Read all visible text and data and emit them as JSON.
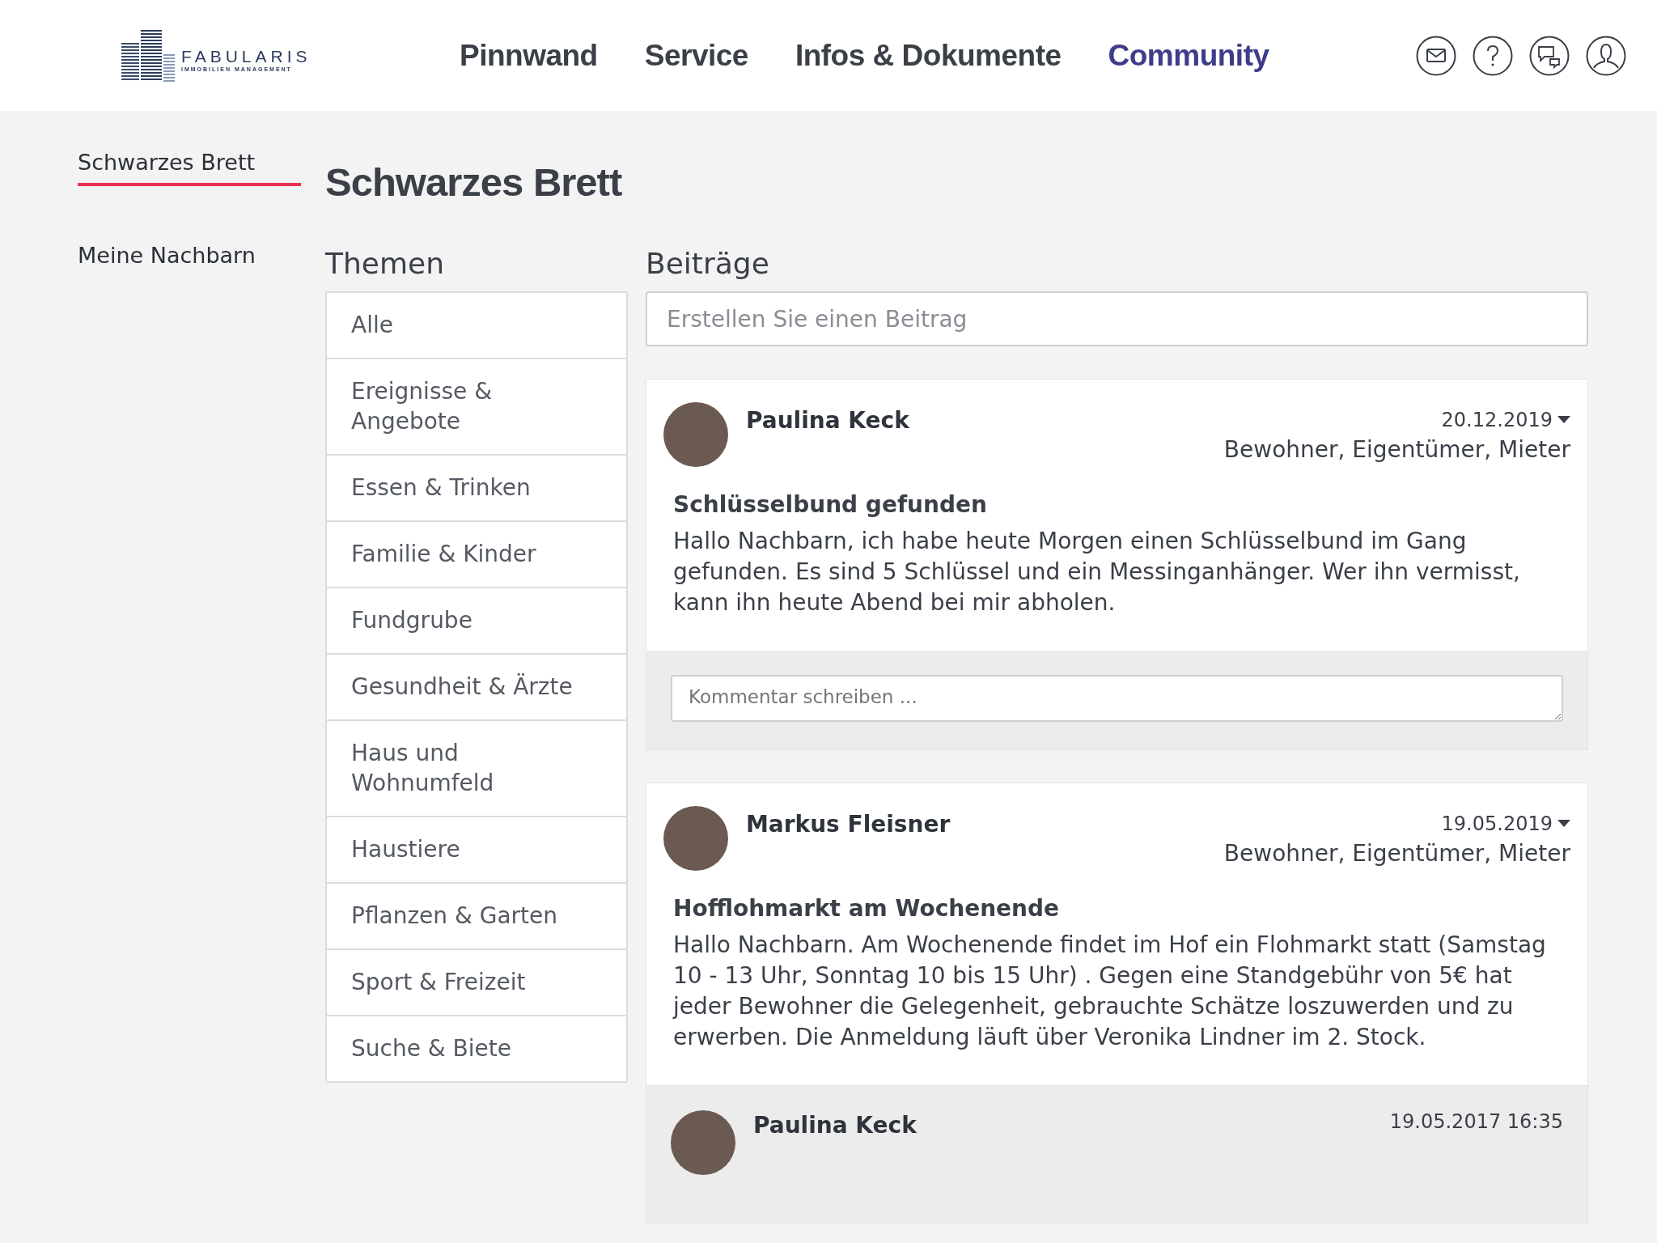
{
  "header": {
    "logo": {
      "name": "FABULARIS",
      "tagline": "IMMOBILIEN MANAGEMENT"
    },
    "nav": [
      {
        "label": "Pinnwand",
        "selected": false
      },
      {
        "label": "Service",
        "selected": false
      },
      {
        "label": "Infos & Dokumente",
        "selected": false
      },
      {
        "label": "Community",
        "selected": true
      }
    ],
    "icons": [
      {
        "kind": "mail"
      },
      {
        "kind": "help"
      },
      {
        "kind": "chat"
      },
      {
        "kind": "profile"
      }
    ]
  },
  "sidebar": {
    "items": [
      {
        "label": "Schwarzes Brett",
        "selected": true
      },
      {
        "label": "Meine Nachbarn",
        "selected": false
      }
    ]
  },
  "page_title": "Schwarzes Brett",
  "topics": {
    "heading": "Themen",
    "items": [
      "Alle",
      "Ereignisse & Angebote",
      "Essen & Trinken",
      "Familie & Kinder",
      "Fundgrube",
      "Gesundheit & Ärzte",
      "Haus und Wohnumfeld",
      "Haustiere",
      "Pflanzen & Garten",
      "Sport & Freizeit",
      "Suche & Biete"
    ]
  },
  "posts_section": {
    "heading": "Beiträge",
    "new_post": {
      "placeholder": "Erstellen Sie einen Beitrag"
    },
    "posts": [
      {
        "author": "Paulina Keck",
        "date": "20.12.2019",
        "audience": "Bewohner, Eigentümer, Mieter",
        "title": "Schlüsselbund gefunden",
        "text": "Hallo Nachbarn, ich habe heute Morgen einen Schlüsselbund im Gang gefunden. Es sind 5 Schlüssel und ein Messinganhänger. Wer ihn vermisst, kann ihn heute Abend bei mir abholen.",
        "comment_field": {
          "placeholder": "Kommentar schreiben ..."
        }
      },
      {
        "author": "Markus Fleisner",
        "date": "19.05.2019",
        "audience": "Bewohner, Eigentümer, Mieter",
        "title": "Hofflohmarkt am Wochenende",
        "text": "Hallo Nachbarn. Am Wochenende findet im Hof ein Flohmarkt statt (Samstag 10 - 13 Uhr, Sonntag 10 bis 15 Uhr) . Gegen eine Standgebühr von 5€ hat jeder Bewohner die Gelegenheit, gebrauchte Schätze loszuwerden und zu erwerben. Die Anmeldung läuft über Veronika Lindner im 2. Stock.",
        "comments": [
          {
            "author": "Paulina Keck",
            "time": "19.05.2017 16:35"
          }
        ]
      }
    ]
  }
}
